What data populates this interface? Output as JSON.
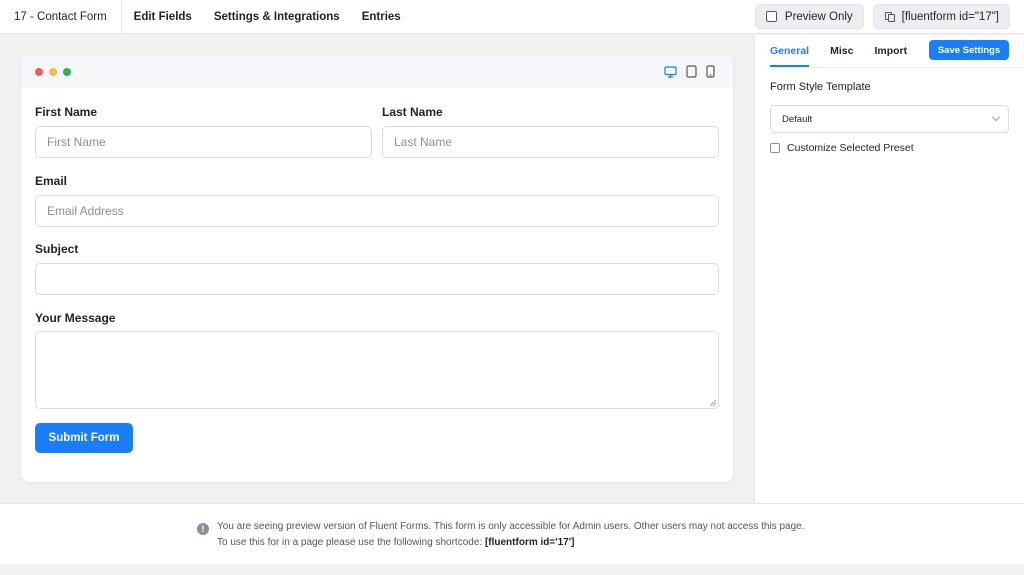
{
  "topbar": {
    "form_name": "17 - Contact Form",
    "nav": [
      "Edit Fields",
      "Settings & Integrations",
      "Entries"
    ],
    "preview_label": "Preview Only",
    "shortcode_label": "[fluentform id=\"17\"]"
  },
  "window": {
    "dot_colors": [
      "#ec5f57",
      "#f4bd4f",
      "#2bb34c"
    ],
    "device_icons": [
      "desktop-icon",
      "tablet-icon",
      "mobile-icon"
    ],
    "active_device_color": "#1a7efb"
  },
  "form": {
    "first_name_label": "First Name",
    "first_name_placeholder": "First Name",
    "last_name_label": "Last Name",
    "last_name_placeholder": "Last Name",
    "email_label": "Email",
    "email_placeholder": "Email Address",
    "subject_label": "Subject",
    "message_label": "Your Message",
    "submit_label": "Submit Form"
  },
  "panel": {
    "tabs": [
      "General",
      "Misc",
      "Import"
    ],
    "active_tab": "General",
    "save_label": "Save Settings",
    "style_template_label": "Form Style Template",
    "style_template_value": "Default",
    "customize_label": "Customize Selected Preset"
  },
  "notice": {
    "line1": "You are seeing preview version of Fluent Forms. This form is only accessible for Admin users. Other users may not access this page.",
    "line2_prefix": "To use this for in a page please use the following shortcode: ",
    "line2_code": "[fluentform id='17']"
  },
  "colors": {
    "accent": "#1a7efb"
  }
}
